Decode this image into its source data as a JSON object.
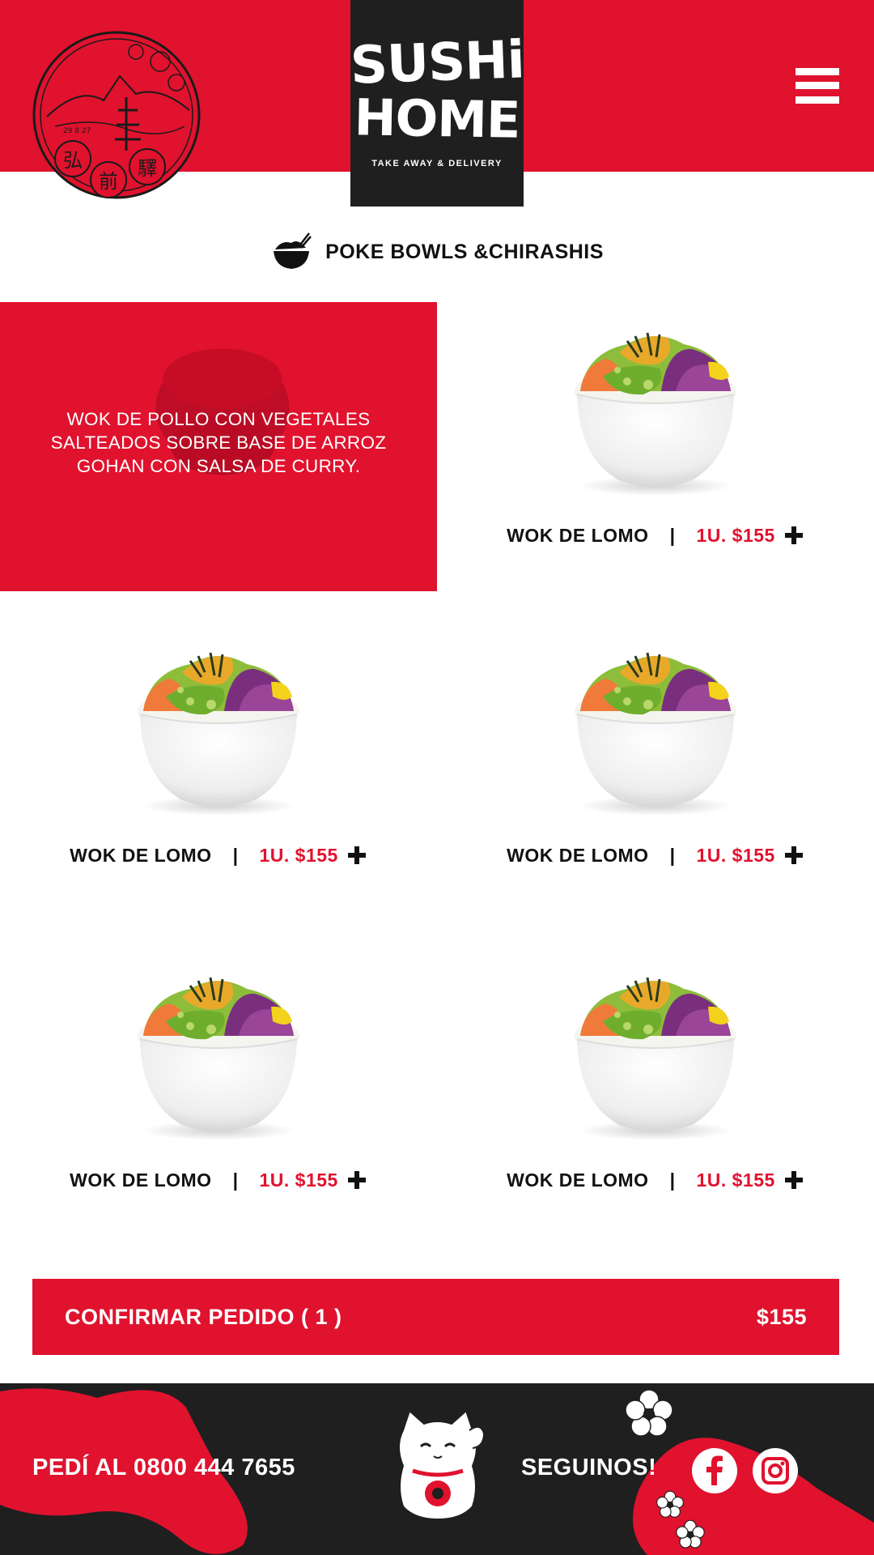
{
  "header": {
    "brand_line1": "SUSHi",
    "brand_line2": "HOME",
    "brand_tagline": "TAKE AWAY & DELIVERY",
    "stamp_date": "29 8 27",
    "stamp_chars": [
      "弘",
      "前",
      "驛"
    ],
    "menu_icon": "hamburger-menu-icon"
  },
  "category": {
    "icon": "rice-bowl-chopsticks-icon",
    "label": "POKE BOWLS &CHIRASHIS"
  },
  "featured": {
    "description": "WOK DE POLLO CON VEGETALES SALTEADOS SOBRE BASE DE ARROZ GOHAN CON SALSA DE CURRY."
  },
  "products": [
    {
      "name": "WOK DE LOMO",
      "separator": "|",
      "price": "1U. $155"
    },
    {
      "name": "WOK DE LOMO",
      "separator": "|",
      "price": "1U. $155"
    },
    {
      "name": "WOK DE LOMO",
      "separator": "|",
      "price": "1U. $155"
    },
    {
      "name": "WOK DE LOMO",
      "separator": "|",
      "price": "1U. $155"
    },
    {
      "name": "WOK DE LOMO",
      "separator": "|",
      "price": "1U. $155"
    }
  ],
  "confirm": {
    "label": "CONFIRMAR PEDIDO ( 1 )",
    "total": "$155"
  },
  "footer": {
    "phone": "PEDÍ AL 0800 444 7655",
    "follow": "SEGUINOS!",
    "social": [
      "facebook-icon",
      "instagram-icon"
    ]
  },
  "colors": {
    "brand_red": "#e0122e",
    "dark": "#1f1f1f",
    "white": "#ffffff"
  }
}
